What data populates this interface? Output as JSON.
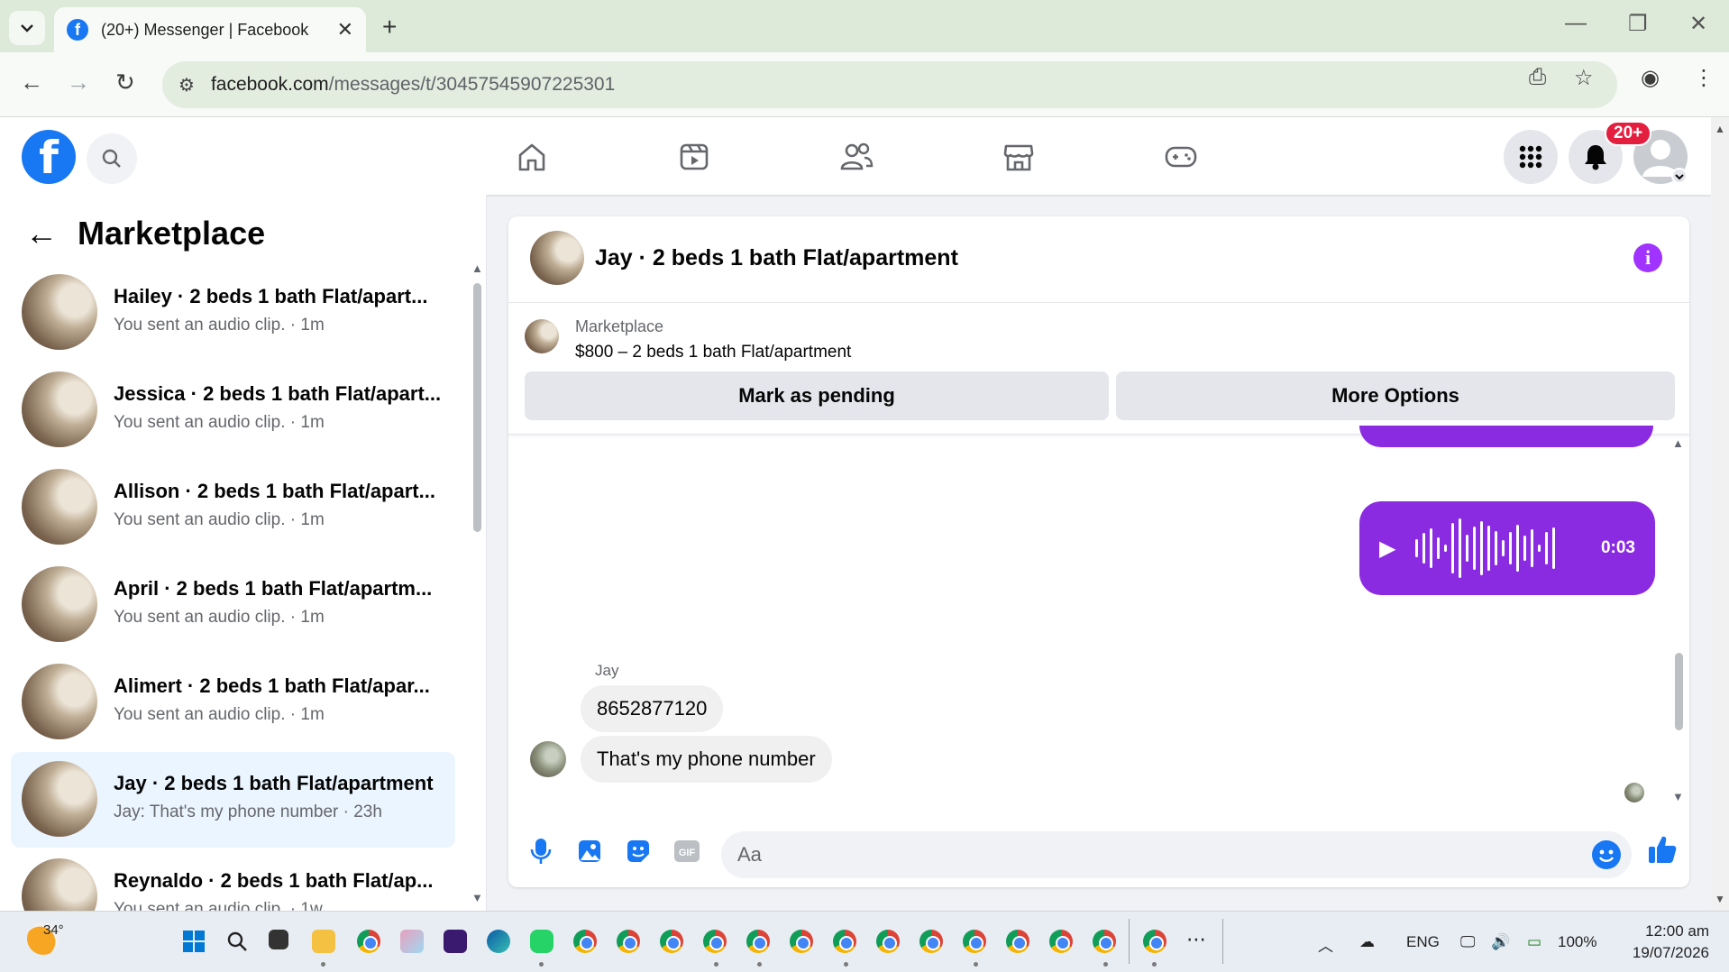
{
  "browser": {
    "tab_title": "(20+) Messenger | Facebook",
    "url_host": "facebook.com",
    "url_path": "/messages/t/30457545907225301"
  },
  "fb_nav": {
    "notification_badge": "20+"
  },
  "left_panel": {
    "title": "Marketplace",
    "conversations": [
      {
        "name": "Hailey · 2 beds 1 bath Flat/apart...",
        "subtitle": "You sent an audio clip. · 1m",
        "active": false
      },
      {
        "name": "Jessica · 2 beds 1 bath Flat/apart...",
        "subtitle": "You sent an audio clip. · 1m",
        "active": false
      },
      {
        "name": "Allison · 2 beds 1 bath Flat/apart...",
        "subtitle": "You sent an audio clip. · 1m",
        "active": false
      },
      {
        "name": "April · 2 beds 1 bath Flat/apartm...",
        "subtitle": "You sent an audio clip. · 1m",
        "active": false
      },
      {
        "name": "Alimert · 2 beds 1 bath Flat/apar...",
        "subtitle": "You sent an audio clip. · 1m",
        "active": false
      },
      {
        "name": "Jay · 2 beds 1 bath Flat/apartment",
        "subtitle": "Jay: That's my phone number · 23h",
        "active": true
      },
      {
        "name": "Reynaldo · 2 beds 1 bath Flat/ap...",
        "subtitle": "You sent an audio clip. · 1w",
        "active": false
      }
    ]
  },
  "chat": {
    "header_name": "Jay · 2 beds 1 bath Flat/apartment",
    "listing": {
      "source": "Marketplace",
      "price_title": "$800 – 2 beds 1 bath Flat/apartment",
      "mark_pending_label": "Mark as pending",
      "more_options_label": "More Options"
    },
    "audio_duration": "0:03",
    "sender_name": "Jay",
    "messages": [
      "8652877120",
      "That's my phone number"
    ],
    "composer_placeholder": "Aa"
  },
  "taskbar": {
    "temperature": "34°",
    "language": "ENG",
    "battery": "100%",
    "time": "12:00 am",
    "date": "19/07/2026"
  },
  "colors": {
    "facebook_blue": "#1877f2",
    "messenger_purple": "#8a2be2",
    "active_conversation_bg": "#ebf5ff",
    "badge_red": "#e41e3f"
  }
}
